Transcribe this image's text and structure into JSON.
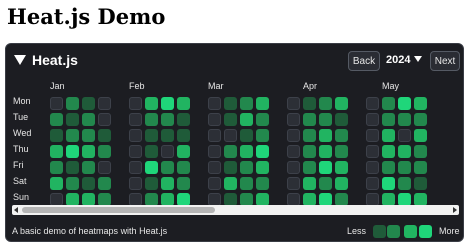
{
  "page": {
    "title": "Heat.js Demo"
  },
  "header": {
    "title": "Heat.js",
    "back_label": "Back",
    "year": "2024",
    "next_label": "Next"
  },
  "months": [
    "Jan",
    "Feb",
    "Mar",
    "Apr",
    "May"
  ],
  "days": [
    "Mon",
    "Tue",
    "Wed",
    "Thu",
    "Fri",
    "Sat",
    "Sun"
  ],
  "colors": {
    "panel": "#1c1d22",
    "empty": "#2c2f36",
    "empty_border": "#3d414a",
    "level1": "#1f5b39",
    "level2": "#22884d",
    "level3": "#21b461",
    "level4": "#1fd67a"
  },
  "heatmap_weeks": [
    [
      0,
      2,
      1,
      3,
      2,
      3,
      0
    ],
    [
      2,
      1,
      2,
      4,
      1,
      2,
      3
    ],
    [
      1,
      2,
      2,
      3,
      2,
      1,
      3
    ],
    [
      0,
      0,
      1,
      2,
      0,
      2,
      2
    ],
    [
      2,
      1,
      3,
      3,
      2,
      4,
      2
    ],
    [
      0,
      0,
      0,
      0,
      0,
      0,
      0
    ],
    [
      3,
      2,
      1,
      1,
      4,
      1,
      2
    ],
    [
      4,
      2,
      1,
      0,
      2,
      3,
      3
    ],
    [
      3,
      1,
      1,
      3,
      2,
      2,
      4
    ],
    [
      2,
      0,
      1,
      2,
      2,
      2,
      3
    ],
    [
      0,
      0,
      0,
      0,
      0,
      0,
      0
    ],
    [
      1,
      1,
      0,
      2,
      1,
      3,
      1
    ],
    [
      2,
      3,
      1,
      3,
      2,
      2,
      2
    ],
    [
      3,
      2,
      2,
      4,
      3,
      2,
      3
    ],
    [
      2,
      3,
      3,
      2,
      2,
      1,
      2
    ],
    [
      0,
      0,
      0,
      0,
      0,
      0,
      0
    ],
    [
      1,
      2,
      2,
      2,
      2,
      3,
      3
    ],
    [
      2,
      2,
      3,
      3,
      4,
      2,
      4
    ],
    [
      3,
      1,
      2,
      2,
      3,
      3,
      2
    ],
    [
      2,
      2,
      2,
      3,
      2,
      2,
      4
    ],
    [
      0,
      0,
      0,
      0,
      0,
      0,
      0
    ],
    [
      2,
      2,
      3,
      3,
      2,
      4,
      3
    ],
    [
      4,
      2,
      0,
      3,
      2,
      2,
      4
    ],
    [
      3,
      2,
      3,
      2,
      2,
      1,
      3
    ],
    [
      2,
      2,
      2,
      0,
      2,
      3,
      3
    ]
  ],
  "legend": {
    "less_label": "Less",
    "more_label": "More",
    "levels": [
      1,
      2,
      3,
      4
    ]
  },
  "footer": {
    "description": "A basic demo of heatmaps with Heat.js"
  }
}
